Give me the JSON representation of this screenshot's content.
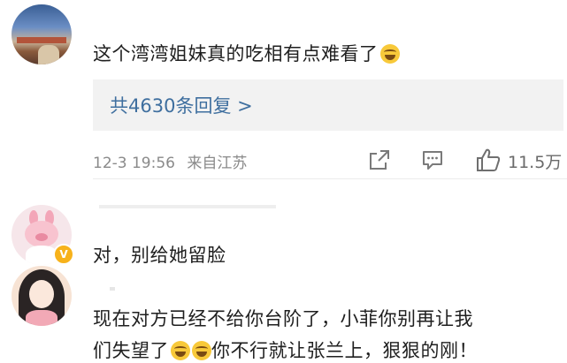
{
  "comments": [
    {
      "text": "这个湾湾姐妹真的吃相有点难看了",
      "emoji": "laugh-cry",
      "replies_label": "共4630条回复 >",
      "timestamp": "12-3 19:56",
      "source": "来自江苏",
      "likes": "11.5万"
    },
    {
      "text": "对，别给她留脸",
      "badge": "V"
    },
    {
      "text_line1": "现在对方已经不给你台阶了，小菲你别再让我",
      "text_line2_a": "们失望了",
      "text_line2_b": "你不行就让张兰上，狠狠的刚！"
    }
  ],
  "colors": {
    "link": "#3f6f9f",
    "meta": "#8a8a8a",
    "reply_bg": "#f2f2f2",
    "badge": "#f7b21b"
  },
  "icons": [
    "share-icon",
    "comment-icon",
    "like-icon"
  ]
}
